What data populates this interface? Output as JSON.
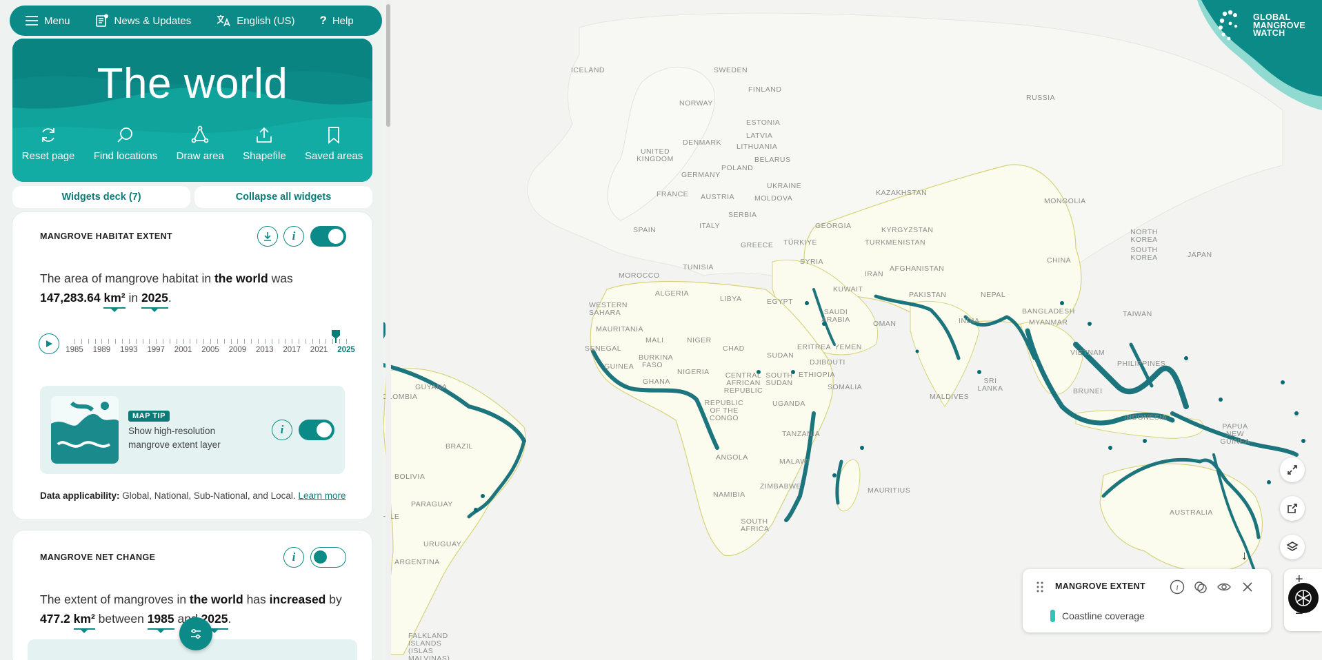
{
  "nav": {
    "menu": "Menu",
    "news": "News & Updates",
    "language": "English (US)",
    "help": "Help"
  },
  "hero": {
    "title": "The world",
    "tools": [
      "Reset page",
      "Find locations",
      "Draw area",
      "Shapefile",
      "Saved areas"
    ]
  },
  "deck": {
    "widgets_deck": "Widgets deck (7)",
    "collapse": "Collapse all widgets"
  },
  "widget_extent": {
    "title": "MANGROVE HABITAT EXTENT",
    "text_pre": "The area of mangrove habitat in ",
    "location": "the world",
    "text_was": " was",
    "area": "147,283.64",
    "unit": "km²",
    "text_in": " in ",
    "year": "2025",
    "text_end": ".",
    "years": [
      "1985",
      "1989",
      "1993",
      "1997",
      "2001",
      "2005",
      "2009",
      "2013",
      "2017",
      "2021",
      "2025"
    ],
    "selected_year": "2025",
    "tip_badge": "MAP TIP",
    "tip_text": "Show high-resolution mangrove extent layer",
    "applicability_label": "Data applicability:",
    "applicability_value": " Global, National, Sub-National, and Local. ",
    "learn_more": "Learn more"
  },
  "widget_net": {
    "title": "MANGROVE NET CHANGE",
    "text_pre": "The extent of mangroves in ",
    "location": "the world",
    "text_has": " has ",
    "trend": "increased",
    "text_by": " by",
    "value": "477.2",
    "unit": "km²",
    "text_between": " between ",
    "year_start": "1985",
    "text_and": " and ",
    "year_end": "2025",
    "text_end": "."
  },
  "brand": {
    "line1": "GLOBAL",
    "line2": "MANGROVE",
    "line3": "WATCH"
  },
  "legend": {
    "title": "MANGROVE EXTENT",
    "item": "Coastline coverage"
  },
  "map_labels": [
    {
      "text": "ICELAND"
    },
    {
      "text": "SWEDEN"
    },
    {
      "text": "FINLAND"
    },
    {
      "text": "NORWAY"
    },
    {
      "text": "ESTONIA"
    },
    {
      "text": "LATVIA"
    },
    {
      "text": "LITHUANIA"
    },
    {
      "text": "DENMARK"
    },
    {
      "text": "UNITED KINGDOM"
    },
    {
      "text": "BELARUS"
    },
    {
      "text": "POLAND"
    },
    {
      "text": "GERMANY"
    },
    {
      "text": "UKRAINE"
    },
    {
      "text": "FRANCE"
    },
    {
      "text": "AUSTRIA"
    },
    {
      "text": "MOLDOVA"
    },
    {
      "text": "SERBIA"
    },
    {
      "text": "SPAIN"
    },
    {
      "text": "ITALY"
    },
    {
      "text": "GEORGIA"
    },
    {
      "text": "GREECE"
    },
    {
      "text": "TÜRKIYE"
    },
    {
      "text": "RUSSIA"
    },
    {
      "text": "KAZAKHSTAN"
    },
    {
      "text": "MONGOLIA"
    },
    {
      "text": "KYRGYZSTAN"
    },
    {
      "text": "TURKMENISTAN"
    },
    {
      "text": "NORTH KOREA"
    },
    {
      "text": "SOUTH KOREA"
    },
    {
      "text": "JAPAN"
    },
    {
      "text": "CHINA"
    },
    {
      "text": "AFGHANISTAN"
    },
    {
      "text": "IRAN"
    },
    {
      "text": "SYRIA"
    },
    {
      "text": "TUNISIA"
    },
    {
      "text": "MOROCCO"
    },
    {
      "text": "ALGERIA"
    },
    {
      "text": "LIBYA"
    },
    {
      "text": "EGYPT"
    },
    {
      "text": "KUWAIT"
    },
    {
      "text": "PAKISTAN"
    },
    {
      "text": "NEPAL"
    },
    {
      "text": "BANGLADESH"
    },
    {
      "text": "INDIA"
    },
    {
      "text": "MYANMAR"
    },
    {
      "text": "TAIWAN"
    },
    {
      "text": "SAUDI ARABIA"
    },
    {
      "text": "OMAN"
    },
    {
      "text": "WESTERN SAHARA"
    },
    {
      "text": "MAURITANIA"
    },
    {
      "text": "MALI"
    },
    {
      "text": "NIGER"
    },
    {
      "text": "CHAD"
    },
    {
      "text": "SUDAN"
    },
    {
      "text": "ERITREA"
    },
    {
      "text": "YEMEN"
    },
    {
      "text": "DJIBOUTI"
    },
    {
      "text": "SENEGAL"
    },
    {
      "text": "GUINEA"
    },
    {
      "text": "BURKINA FASO"
    },
    {
      "text": "GHANA"
    },
    {
      "text": "NIGERIA"
    },
    {
      "text": "CENTRAL AFRICAN REPUBLIC"
    },
    {
      "text": "SOUTH SUDAN"
    },
    {
      "text": "ETHIOPIA"
    },
    {
      "text": "SOMALIA"
    },
    {
      "text": "REPUBLIC OF THE CONGO"
    },
    {
      "text": "UGANDA"
    },
    {
      "text": "TANZANIA"
    },
    {
      "text": "ANGOLA"
    },
    {
      "text": "MALAWI"
    },
    {
      "text": "ZIMBABWE"
    },
    {
      "text": "NAMIBIA"
    },
    {
      "text": "SOUTH AFRICA"
    },
    {
      "text": "MAURITIUS"
    },
    {
      "text": "MALDIVES"
    },
    {
      "text": "SRI LANKA"
    },
    {
      "text": "VIETNAM"
    },
    {
      "text": "PHILIPPINES"
    },
    {
      "text": "BRUNEI"
    },
    {
      "text": "INDONESIA"
    },
    {
      "text": "PAPUA NEW GUINEA"
    },
    {
      "text": "AUSTRALIA"
    },
    {
      "text": "GUYANA"
    },
    {
      "text": "BRAZIL"
    },
    {
      "text": "BOLIVIA"
    },
    {
      "text": "PARAGUAY"
    },
    {
      "text": "URUGUAY"
    },
    {
      "text": "ARGENTINA"
    },
    {
      "text": "CHILE"
    },
    {
      "text": "COLOMBIA"
    },
    {
      "text": "FALKLAND ISLANDS (ISLAS MALVINAS)"
    }
  ],
  "colors": {
    "brand_teal": "#0b8a87",
    "mangrove": "#0a6a74",
    "land": "#fbfbf0",
    "border": "#d8d37a"
  }
}
